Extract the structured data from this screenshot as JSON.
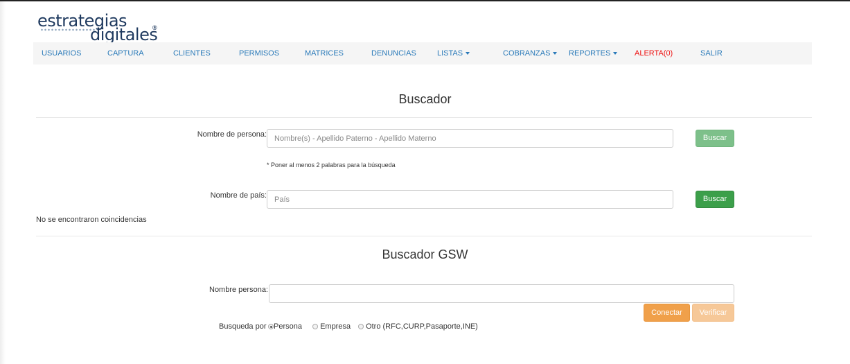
{
  "logo": {
    "line1": "estrategias",
    "line2": "digitales",
    "reg": "®"
  },
  "nav": {
    "items": [
      {
        "label": "USUARIOS",
        "dropdown": false
      },
      {
        "label": "CAPTURA",
        "dropdown": false
      },
      {
        "label": "CLIENTES",
        "dropdown": false
      },
      {
        "label": "PERMISOS",
        "dropdown": false
      },
      {
        "label": "MATRICES",
        "dropdown": false
      },
      {
        "label": "DENUNCIAS",
        "dropdown": false
      },
      {
        "label": "LISTAS",
        "dropdown": true
      },
      {
        "label": "COBRANZAS",
        "dropdown": true
      },
      {
        "label": "REPORTES",
        "dropdown": true
      },
      {
        "label": "ALERTA(0)",
        "dropdown": false
      },
      {
        "label": "SALIR",
        "dropdown": false
      }
    ],
    "link_color": "#2a7ab9",
    "alert_color": "#ee1111"
  },
  "buscador": {
    "title": "Buscador",
    "persona_label": "Nombre de persona:",
    "persona_placeholder": "Nombre(s) - Apellido Paterno - Apellido Materno",
    "persona_value": "",
    "persona_button": "Buscar",
    "note": "* Poner al menos 2 palabras para la búsqueda",
    "pais_label": "Nombre de país:",
    "pais_placeholder": "País",
    "pais_value": "",
    "pais_button": "Buscar",
    "no_results": "No se encontraron coincidencias"
  },
  "gsw": {
    "title": "Buscador GSW",
    "persona_label": "Nombre persona:",
    "persona_value": "",
    "connect_button": "Conectar",
    "verify_button": "Verificar",
    "search_by_label": "Busqueda por",
    "options": [
      {
        "label": "Persona",
        "checked": true
      },
      {
        "label": "Empresa",
        "checked": false
      },
      {
        "label": "Otro (RFC,CURP,Pasaporte,INE)",
        "checked": false
      }
    ]
  },
  "colors": {
    "green": "#3c9f4a",
    "green_light": "#7dc08a",
    "orange": "#f0a04a",
    "orange_light": "#f6c898"
  }
}
